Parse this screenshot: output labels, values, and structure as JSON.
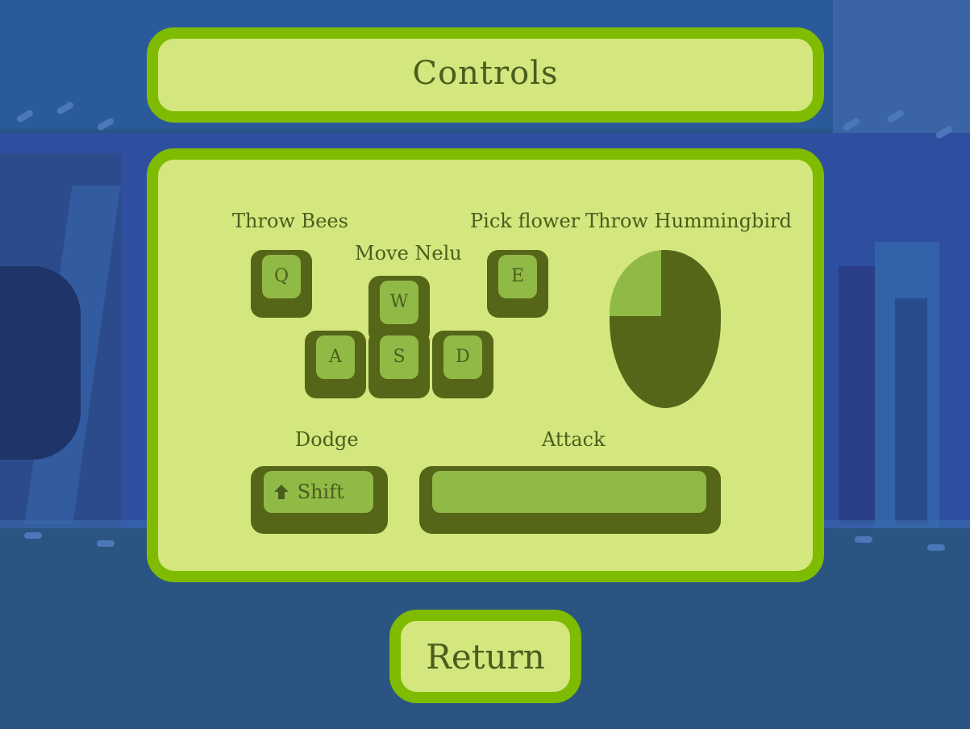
{
  "title": "Controls",
  "controls": {
    "throw_bees": {
      "label": "Throw Bees",
      "key": "Q"
    },
    "move": {
      "label": "Move Nelu",
      "keys": {
        "up": "W",
        "left": "A",
        "down": "S",
        "right": "D"
      }
    },
    "pick_flower": {
      "label": "Pick flower",
      "key": "E"
    },
    "throw_hummingbird": {
      "label": "Throw Hummingbird",
      "input": "left-mouse-button"
    },
    "dodge": {
      "label": "Dodge",
      "key": "Shift",
      "icon": "shift-arrow-icon"
    },
    "attack": {
      "label": "Attack",
      "key": ""
    }
  },
  "return_label": "Return",
  "colors": {
    "panel_fill": "#d4e67e",
    "panel_border": "#7fbb00",
    "key_dark": "#556618",
    "key_light": "#91b946",
    "text": "#4a5e1c",
    "background": "#2a5482"
  }
}
